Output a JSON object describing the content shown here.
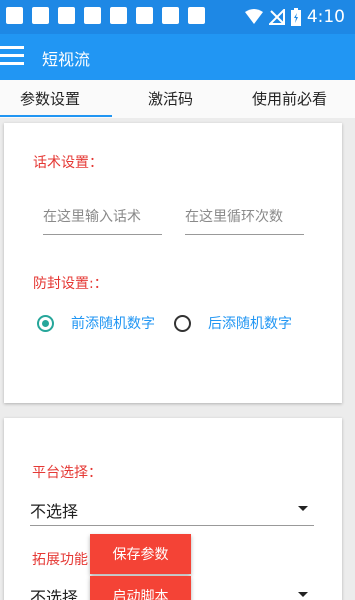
{
  "status_bar": {
    "time": "4:10",
    "icons": [
      "notification-square-icon",
      "notification-square-icon",
      "notification-square-icon",
      "notification-square-icon",
      "notification-square-icon",
      "notification-square-icon",
      "notification-square-icon",
      "notification-square-icon",
      "wifi-icon",
      "no-signal-icon",
      "battery-icon"
    ]
  },
  "app_bar": {
    "title": "短视流",
    "menu_icon": "hamburger-menu-icon"
  },
  "tabs": [
    {
      "label": "参数设置",
      "active": true
    },
    {
      "label": "激活码",
      "active": false
    },
    {
      "label": "使用前必看",
      "active": false
    }
  ],
  "script_card": {
    "title": "话术设置：",
    "phrase_input_placeholder": "在这里输入话术",
    "loop_input_placeholder": "在这里循环次数"
  },
  "anti_block": {
    "title": "防封设置:：",
    "options": [
      {
        "label": "前添随机数字",
        "checked": true
      },
      {
        "label": "后添随机数字",
        "checked": false
      }
    ]
  },
  "platform": {
    "title": "平台选择：",
    "selected": "不选择"
  },
  "extension": {
    "title": "拓展功能",
    "selected": "不选择"
  },
  "actions": {
    "save_label": "保存参数",
    "start_label": "启动脚本"
  },
  "colors": {
    "status_bar": "#1e88e5",
    "app_bar": "#2196f3",
    "section_label": "#e53935",
    "radio_checked": "#26a69a",
    "radio_label": "#2196f3",
    "action_button": "#f44336"
  }
}
